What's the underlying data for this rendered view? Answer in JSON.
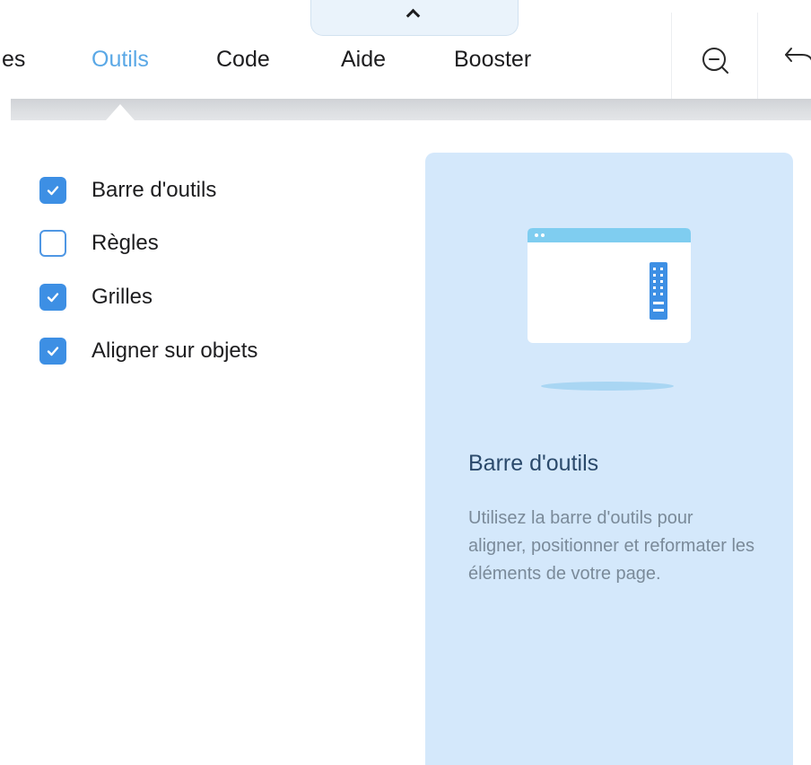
{
  "menu": {
    "partial_label": "es",
    "items": [
      {
        "label": "Outils",
        "active": true
      },
      {
        "label": "Code",
        "active": false
      },
      {
        "label": "Aide",
        "active": false
      },
      {
        "label": "Booster",
        "active": false
      }
    ],
    "collapse_icon": "chevron-up-icon",
    "zoom_icon": "zoom-out-icon",
    "undo_icon": "undo-icon"
  },
  "options": [
    {
      "label": "Barre d'outils",
      "checked": true
    },
    {
      "label": "Règles",
      "checked": false
    },
    {
      "label": "Grilles",
      "checked": true
    },
    {
      "label": "Aligner sur objets",
      "checked": true
    }
  ],
  "info": {
    "title": "Barre d'outils",
    "description": "Utilisez la barre d'outils pour aligner, positionner et reformater les éléments de votre page.",
    "illustration_icon": "toolbar-illustration-icon"
  },
  "colors": {
    "accent": "#3d8fe4",
    "active_menu": "#5aa8e6",
    "panel_bg": "#d4e8fb",
    "text": "#1d1d1f"
  }
}
